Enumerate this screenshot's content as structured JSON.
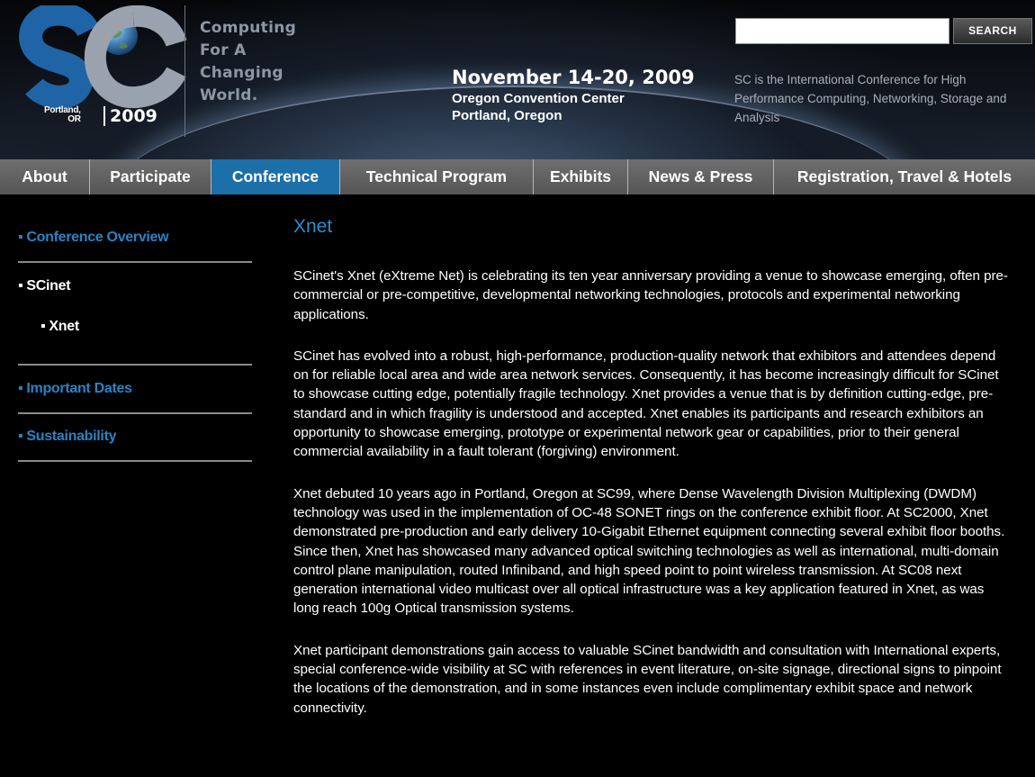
{
  "header": {
    "logo": {
      "letters": "SC",
      "place_line1": "Portland,",
      "place_line2": "OR",
      "year": "2009"
    },
    "tagline": [
      "Computing",
      "For A",
      "Changing",
      "World."
    ],
    "dates": {
      "main": "November 14-20, 2009",
      "venue": "Oregon Convention Center",
      "city": "Portland, Oregon"
    },
    "description": "SC is the International Conference for High Performance Computing, Networking, Storage and Analysis",
    "search": {
      "value": "",
      "button_label": "SEARCH"
    }
  },
  "nav": {
    "items": [
      {
        "label": "About",
        "active": false
      },
      {
        "label": "Participate",
        "active": false
      },
      {
        "label": "Conference",
        "active": true
      },
      {
        "label": "Technical Program",
        "active": false
      },
      {
        "label": "Exhibits",
        "active": false
      },
      {
        "label": "News & Press",
        "active": false
      },
      {
        "label": "Registration, Travel & Hotels",
        "active": false
      }
    ]
  },
  "sidebar": {
    "bullet": "▪",
    "items": [
      {
        "label": "Conference Overview",
        "state": "link"
      },
      {
        "label": "SCinet",
        "state": "current"
      },
      {
        "label": "Xnet",
        "state": "current-sub"
      },
      {
        "label": "Important Dates",
        "state": "link"
      },
      {
        "label": "Sustainability",
        "state": "link"
      }
    ]
  },
  "main": {
    "title": "Xnet",
    "paragraphs": [
      "SCinet's Xnet (eXtreme Net) is celebrating its ten year anniversary providing a venue to showcase emerging, often pre-commercial or pre-competitive, developmental networking technologies, protocols and experimental networking applications.",
      "SCinet has evolved into a robust, high-performance, production-quality network that exhibitors and attendees depend on for reliable local area and wide area network services. Consequently, it has become increasingly difficult for SCinet to showcase cutting edge, potentially fragile technology. Xnet provides a venue that is by definition cutting-edge, pre-standard and in which fragility is understood and accepted. Xnet enables its participants and research exhibitors an opportunity to showcase emerging, prototype or experimental network gear or capabilities, prior to their general commercial availability in a fault tolerant (forgiving) environment.",
      "Xnet debuted 10 years ago in Portland, Oregon at SC99, where Dense Wavelength Division Multiplexing (DWDM) technology was used in the implementation of OC-48 SONET rings on the conference exhibit floor. At SC2000, Xnet demonstrated pre-production and early delivery 10-Gigabit Ethernet equipment connecting several exhibit floor booths. Since then, Xnet has showcased many advanced optical switching technologies as well as international, multi-domain control plane manipulation, routed Infiniband, and high speed point to point wireless transmission. At SC08 next generation international video multicast over all optical infrastructure was a key application featured in Xnet, as was long reach 100g Optical transmission systems.",
      "Xnet participant demonstrations gain access to valuable SCinet bandwidth and consultation with International experts, special conference-wide visibility at SC with references in event literature, on-site signage, directional signs to pinpoint the locations of the demonstration, and in some instances even include complimentary exhibit space and network connectivity."
    ]
  },
  "colors": {
    "link_blue": "#2b82c4",
    "title_blue": "#2e8ccf",
    "nav_active": "#1c6fa8",
    "nav_bg": "#606060",
    "page_bg": "#000000"
  }
}
